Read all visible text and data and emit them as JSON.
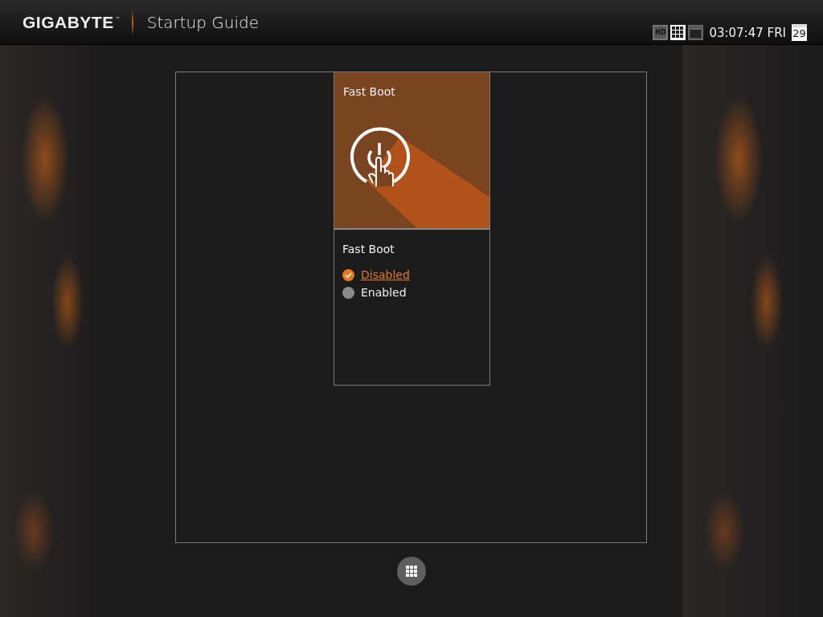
{
  "header": {
    "brand": "GIGABYTE",
    "trademark": "™",
    "title": "Startup Guide",
    "hd_label": "HD",
    "view_modes": [
      {
        "kind": "grid",
        "selected": true
      },
      {
        "kind": "single",
        "selected": false
      }
    ],
    "clock": "03:07:47 FRI",
    "calendar_day": "29"
  },
  "tile": {
    "title": "Fast Boot"
  },
  "setting": {
    "title": "Fast Boot",
    "options": [
      {
        "label": "Disabled",
        "selected": true
      },
      {
        "label": "Enabled",
        "selected": false
      }
    ]
  }
}
